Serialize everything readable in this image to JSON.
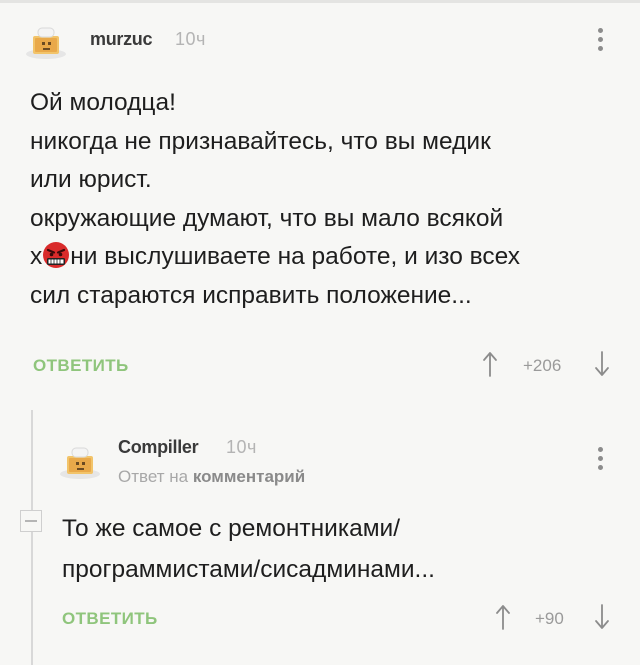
{
  "comments": [
    {
      "username": "murzuc",
      "time": "10ч",
      "lines": [
        "Ой молодца!",
        "никогда не признавайтесь, что вы медик",
        "или юрист.",
        "окружающие думают, что вы мало всякой"
      ],
      "line5_pre": "х",
      "line5_post": "ни выслушиваете на работе,  и изо всех",
      "line6": "сил стараются исправить положение...",
      "reply_label": "ОТВЕТИТЬ",
      "rating": "+206",
      "emoji": "angry-face-emoji"
    },
    {
      "username": "Compiller",
      "time": "10ч",
      "answer_prefix": "Ответ на",
      "answer_target": "комментарий",
      "lines": [
        "То же самое с ремонтниками/",
        "программистами/сисадминами..."
      ],
      "reply_label": "ОТВЕТИТЬ",
      "rating": "+90"
    }
  ],
  "icons": [
    "avatar-icon",
    "more-vertical-icon",
    "arrow-up-icon",
    "arrow-down-icon",
    "collapse-icon"
  ],
  "colors": {
    "accent_green": "#8fc57c",
    "text": "#1e1e1e",
    "muted": "#a8a8a8",
    "background": "#f7f7f5"
  }
}
